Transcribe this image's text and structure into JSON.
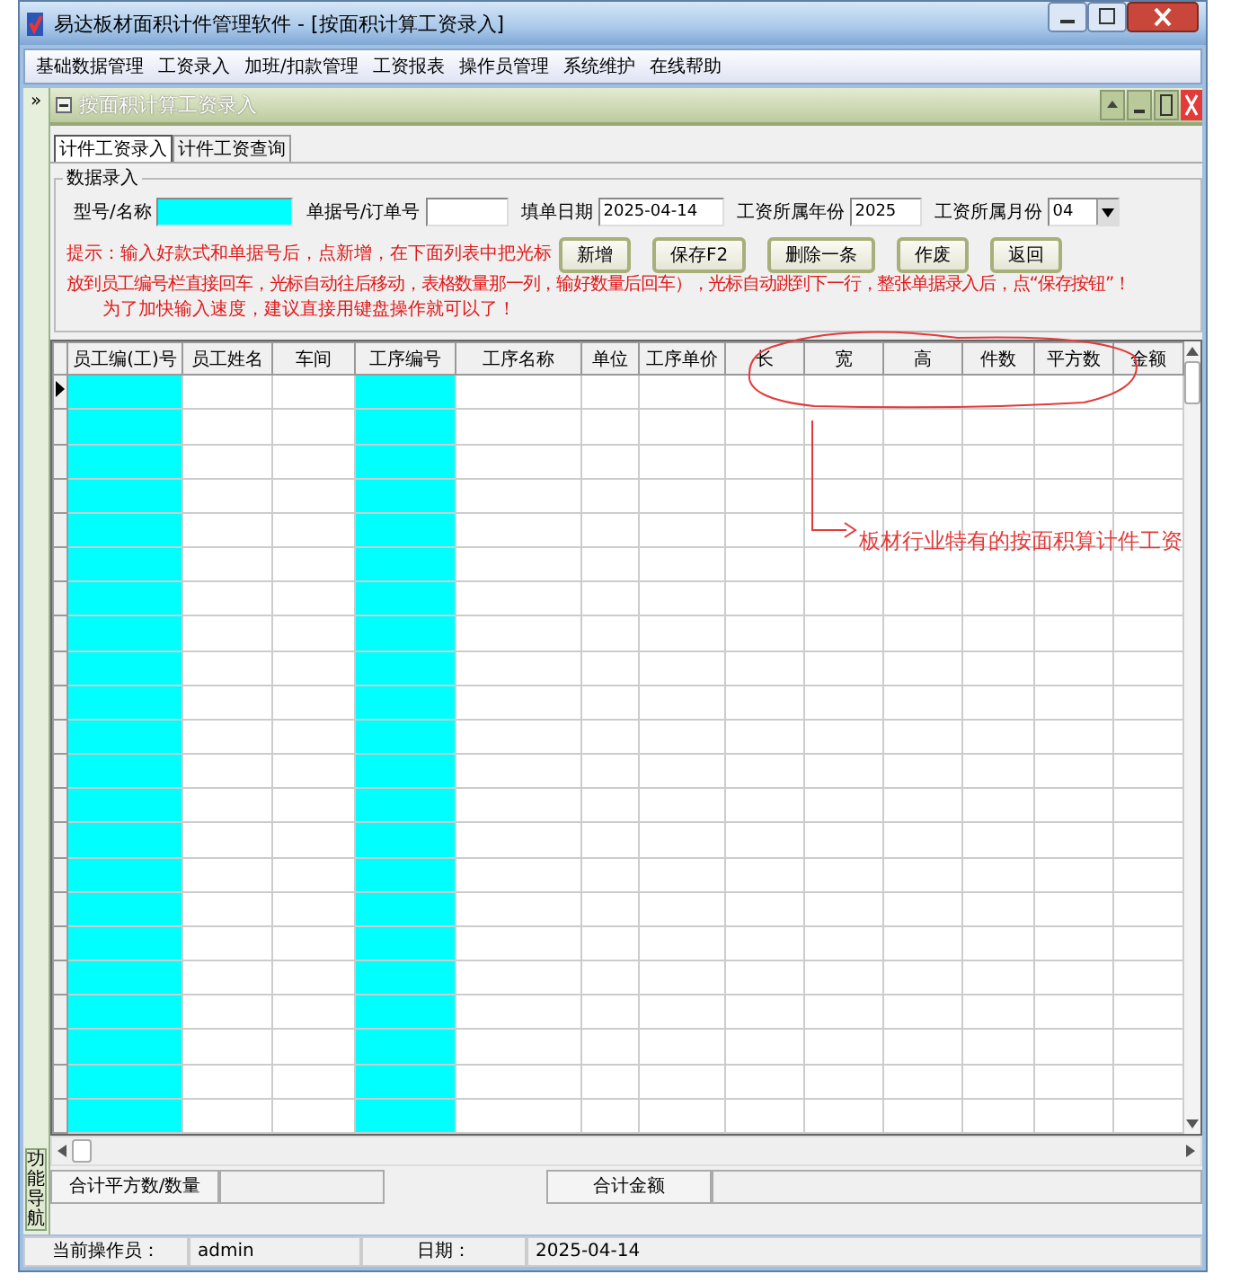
{
  "window": {
    "title": "易达板材面积计件管理软件  - [按面积计算工资录入]"
  },
  "menu": [
    "基础数据管理",
    "工资录入",
    "加班/扣款管理",
    "工资报表",
    "操作员管理",
    "系统维护",
    "在线帮助"
  ],
  "side_panel": {
    "expand": "»",
    "label": "功能导航"
  },
  "child_window": {
    "title": "按面积计算工资录入"
  },
  "tabs": [
    {
      "label": "计件工资录入",
      "selected": true
    },
    {
      "label": "计件工资查询",
      "selected": false
    }
  ],
  "group": {
    "title": "数据录入",
    "fields": [
      {
        "label": "型号/名称",
        "kind": "text",
        "highlighted": true
      },
      {
        "label": "单据号/订单号",
        "kind": "text",
        "highlighted": false
      },
      {
        "label": "填单日期",
        "kind": "text",
        "highlighted": false,
        "value": "2025-04-14"
      },
      {
        "label": "工资所属年份",
        "kind": "text",
        "highlighted": false,
        "value": "2025"
      },
      {
        "label": "工资所属月份",
        "kind": "select",
        "highlighted": false,
        "value": "04"
      }
    ],
    "buttons": [
      "新增",
      "保存F2",
      "删除一条",
      "作废",
      "返回"
    ],
    "hint": [
      "提示：输入好款式和单据号后，点新增，在下面列表中把光标",
      "放到员工编号栏直接回车，光标自动往后移动，表格数量那一列，输好数量后回车），光标自动跳到下一行，整张单据录入后，点“保存按钮”！",
      "为了加快输入速度，建议直接用键盘操作就可以了！"
    ]
  },
  "table": {
    "columns": [
      {
        "label": "员工编(工)号",
        "highlighted": true
      },
      {
        "label": "员工姓名",
        "highlighted": false
      },
      {
        "label": "车间",
        "highlighted": false
      },
      {
        "label": "工序编号",
        "highlighted": true
      },
      {
        "label": "工序名称",
        "highlighted": false
      },
      {
        "label": "单位",
        "highlighted": false
      },
      {
        "label": "工序单价",
        "highlighted": false
      },
      {
        "label": "长",
        "highlighted": false
      },
      {
        "label": "宽",
        "highlighted": false
      },
      {
        "label": "高",
        "highlighted": false
      },
      {
        "label": "件数",
        "highlighted": false
      },
      {
        "label": "平方数",
        "highlighted": false
      },
      {
        "label": "金额",
        "highlighted": false
      }
    ],
    "rows": [
      {
        "selected": true
      },
      {
        "selected": false
      },
      {
        "selected": false
      },
      {
        "selected": false
      },
      {
        "selected": false
      },
      {
        "selected": false
      },
      {
        "selected": false
      },
      {
        "selected": false
      },
      {
        "selected": false
      },
      {
        "selected": false
      },
      {
        "selected": false
      },
      {
        "selected": false
      },
      {
        "selected": false
      },
      {
        "selected": false
      },
      {
        "selected": false
      },
      {
        "selected": false
      },
      {
        "selected": false
      },
      {
        "selected": false
      },
      {
        "selected": false
      },
      {
        "selected": false
      },
      {
        "selected": false
      },
      {
        "selected": false
      }
    ]
  },
  "totals": [
    {
      "label": "合计平方数/数量"
    },
    {
      "label": "合计金额"
    }
  ],
  "status_bar": [
    {
      "label": "当前操作员：",
      "value": "admin"
    },
    {
      "label": "日期：",
      "value": "2025-04-14"
    }
  ],
  "annotation": {
    "text": "板材行业特有的按面积算计件工资"
  }
}
